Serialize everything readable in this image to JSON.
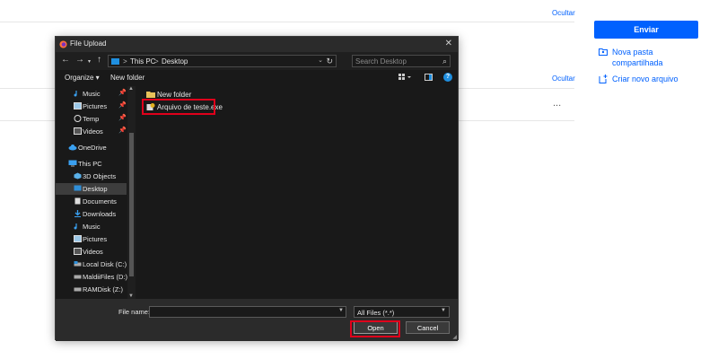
{
  "background_page": {
    "hide_link_1": "Ocultar",
    "hide_link_2": "Ocultar",
    "more_menu": "...",
    "send_button": "Enviar",
    "actions": [
      {
        "label": "Nova pasta compartilhada",
        "icon": "shared-folder-icon"
      },
      {
        "label": "Criar novo arquivo",
        "icon": "new-file-icon"
      }
    ],
    "accent_color": "#0061fe"
  },
  "dialog": {
    "title": "File Upload",
    "address": {
      "crumbs": [
        "This PC",
        "Desktop"
      ],
      "separator": ">"
    },
    "search": {
      "placeholder": "Search Desktop"
    },
    "toolbar": {
      "organize": "Organize ▾",
      "new_folder": "New folder",
      "help": "?"
    },
    "sidebar": {
      "items": [
        {
          "label": "Music",
          "icon": "music-icon",
          "pinned": true
        },
        {
          "label": "Pictures",
          "icon": "pictures-icon",
          "pinned": true
        },
        {
          "label": "Temp",
          "icon": "folder-icon",
          "pinned": true
        },
        {
          "label": "Videos",
          "icon": "videos-icon",
          "pinned": true
        },
        {
          "label": "OneDrive",
          "icon": "cloud-icon",
          "pinned": false
        },
        {
          "label": "This PC",
          "icon": "computer-icon",
          "pinned": false
        },
        {
          "label": "3D Objects",
          "icon": "3d-objects-icon",
          "pinned": false
        },
        {
          "label": "Desktop",
          "icon": "desktop-icon",
          "pinned": false,
          "selected": true
        },
        {
          "label": "Documents",
          "icon": "documents-icon",
          "pinned": false
        },
        {
          "label": "Downloads",
          "icon": "downloads-icon",
          "pinned": false
        },
        {
          "label": "Music",
          "icon": "music-icon",
          "pinned": false
        },
        {
          "label": "Pictures",
          "icon": "pictures-icon",
          "pinned": false
        },
        {
          "label": "Videos",
          "icon": "videos-icon",
          "pinned": false
        },
        {
          "label": "Local Disk (C:)",
          "icon": "disk-icon",
          "pinned": false
        },
        {
          "label": "MaldiiFiles (D:)",
          "icon": "disk-icon",
          "pinned": false
        },
        {
          "label": "RAMDisk (Z:)",
          "icon": "disk-icon",
          "pinned": false
        }
      ]
    },
    "files": [
      {
        "name": "New folder",
        "icon": "folder-icon"
      },
      {
        "name": "Arquivo de teste.exe",
        "icon": "executable-icon"
      }
    ],
    "bottom": {
      "file_name_label": "File name:",
      "file_name_value": "",
      "file_type": "All Files (*.*)",
      "open": "Open",
      "cancel": "Cancel"
    }
  }
}
